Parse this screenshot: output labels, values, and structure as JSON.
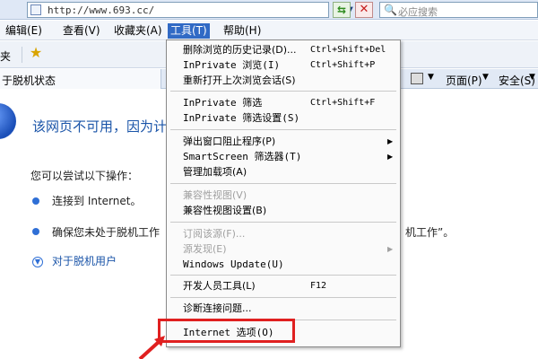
{
  "address_bar": {
    "url": "http://www.693.cc/",
    "search_placeholder": "必应搜索"
  },
  "menu_bar": {
    "items": [
      {
        "label": "编辑(E)"
      },
      {
        "label": "查看(V)"
      },
      {
        "label": "收藏夹(A)"
      },
      {
        "label": "工具(T)"
      },
      {
        "label": "帮助(H)"
      }
    ]
  },
  "favorites_bar": {
    "label": "夹"
  },
  "tab_bar": {
    "tab_label": "于脱机状态",
    "page_label": "页面(P)",
    "safety_label": "安全(S)"
  },
  "content": {
    "heading": "该网页不可用，因为计",
    "try_text": "您可以尝试以下操作：",
    "bullet_1": "连接到 Internet。",
    "bullet_2": "确保您未处于脱机工作",
    "bullet_2_right": "机工作”。",
    "offline_link": "对于脱机用户"
  },
  "tools_menu": {
    "delete_history": "删除浏览的历史记录(D)...",
    "delete_history_shortcut": "Ctrl+Shift+Del",
    "inprivate_browsing": "InPrivate 浏览(I)",
    "inprivate_browsing_shortcut": "Ctrl+Shift+P",
    "reopen_session": "重新打开上次浏览会话(S)",
    "inprivate_filter": "InPrivate 筛选",
    "inprivate_filter_shortcut": "Ctrl+Shift+F",
    "inprivate_filter_settings": "InPrivate 筛选设置(S)",
    "popup_blocker": "弹出窗口阻止程序(P)",
    "smartscreen": "SmartScreen 筛选器(T)",
    "manage_addons": "管理加载项(A)",
    "compat_view": "兼容性视图(V)",
    "compat_view_settings": "兼容性视图设置(B)",
    "subscribe_feed": "订阅该源(F)...",
    "feed_discovery": "源发现(E)",
    "windows_update": "Windows Update(U)",
    "dev_tools": "开发人员工具(L)",
    "dev_tools_shortcut": "F12",
    "diagnose": "诊断连接问题...",
    "internet_options": "Internet 选项(O)"
  }
}
